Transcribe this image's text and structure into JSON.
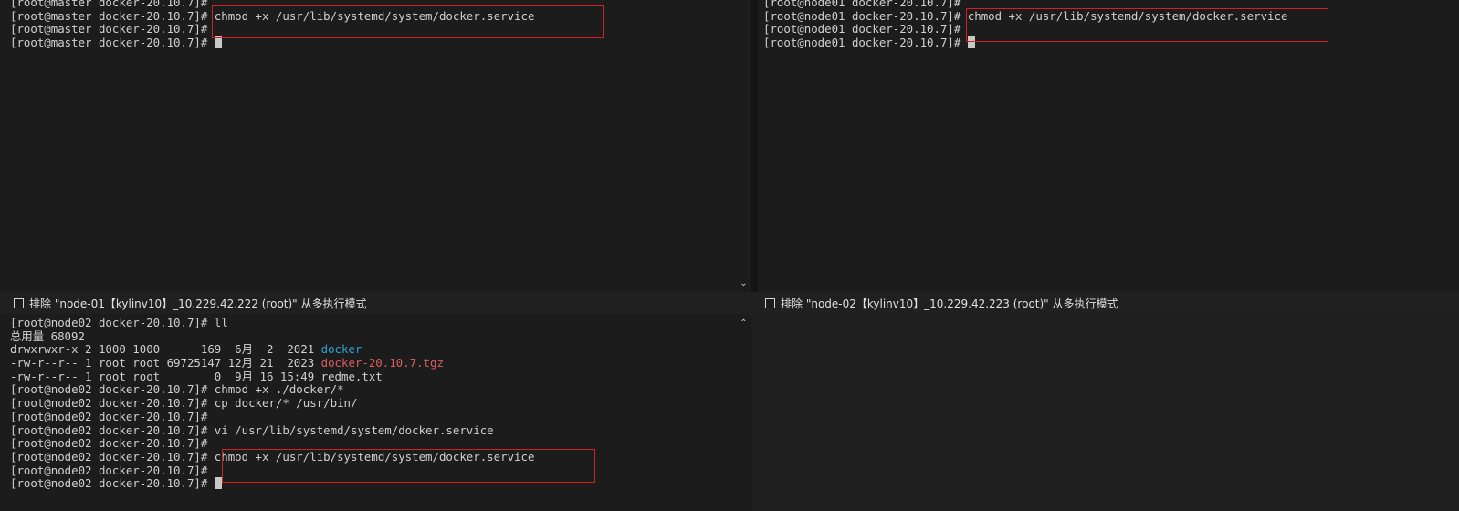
{
  "panes": {
    "top_left": {
      "lines": [
        {
          "segments": [
            {
              "text": "[root@master docker-20.10.7]#"
            }
          ]
        },
        {
          "segments": [
            {
              "text": "[root@master docker-20.10.7]# chmod +x /usr/lib/systemd/system/docker.service"
            }
          ]
        },
        {
          "segments": [
            {
              "text": "[root@master docker-20.10.7]#"
            }
          ]
        },
        {
          "segments": [
            {
              "text": "[root@master docker-20.10.7]# "
            }
          ],
          "cursor": true
        }
      ]
    },
    "top_right": {
      "lines": [
        {
          "segments": [
            {
              "text": "[root@node01 docker-20.10.7]#"
            }
          ]
        },
        {
          "segments": [
            {
              "text": "[root@node01 docker-20.10.7]# chmod +x /usr/lib/systemd/system/docker.service"
            }
          ]
        },
        {
          "segments": [
            {
              "text": "[root@node01 docker-20.10.7]#"
            }
          ]
        },
        {
          "segments": [
            {
              "text": "[root@node01 docker-20.10.7]# "
            }
          ],
          "cursor": true
        }
      ]
    },
    "bottom_left": {
      "lines": [
        {
          "segments": [
            {
              "text": "[root@node02 docker-20.10.7]# ll"
            }
          ]
        },
        {
          "segments": [
            {
              "text": "总用量 68092"
            }
          ]
        },
        {
          "segments": [
            {
              "text": "drwxrwxr-x 2 1000 1000      169  6月  2  2021 "
            },
            {
              "text": "docker",
              "color": "blue"
            }
          ]
        },
        {
          "segments": [
            {
              "text": "-rw-r--r-- 1 root root 69725147 12月 21  2023 "
            },
            {
              "text": "docker-20.10.7.tgz",
              "color": "red"
            }
          ]
        },
        {
          "segments": [
            {
              "text": "-rw-r--r-- 1 root root        0  9月 16 15:49 redme.txt"
            }
          ]
        },
        {
          "segments": [
            {
              "text": "[root@node02 docker-20.10.7]# chmod +x ./docker/*"
            }
          ]
        },
        {
          "segments": [
            {
              "text": "[root@node02 docker-20.10.7]# cp docker/* /usr/bin/"
            }
          ]
        },
        {
          "segments": [
            {
              "text": "[root@node02 docker-20.10.7]#"
            }
          ]
        },
        {
          "segments": [
            {
              "text": "[root@node02 docker-20.10.7]# vi /usr/lib/systemd/system/docker.service"
            }
          ]
        },
        {
          "segments": [
            {
              "text": "[root@node02 docker-20.10.7]#"
            }
          ]
        },
        {
          "segments": [
            {
              "text": "[root@node02 docker-20.10.7]# chmod +x /usr/lib/systemd/system/docker.service"
            }
          ]
        },
        {
          "segments": [
            {
              "text": "[root@node02 docker-20.10.7]#"
            }
          ]
        },
        {
          "segments": [
            {
              "text": "[root@node02 docker-20.10.7]# "
            }
          ],
          "cursor": true
        }
      ]
    },
    "bottom_right": {
      "lines": []
    }
  },
  "status_bars": {
    "left": {
      "label": "排除 \"node-01【kylinv10】_10.229.42.222 (root)\" 从多执行模式"
    },
    "right": {
      "label": "排除 \"node-02【kylinv10】_10.229.42.223 (root)\" 从多执行模式"
    }
  },
  "scroll": {
    "up_glyph": "⌃",
    "down_glyph": "⌄"
  },
  "colors": {
    "background": "#1c1c1c",
    "text": "#d0d0d0",
    "blue": "#2aa3d6",
    "red": "#d95d5d",
    "highlight_box": "#d42020"
  }
}
